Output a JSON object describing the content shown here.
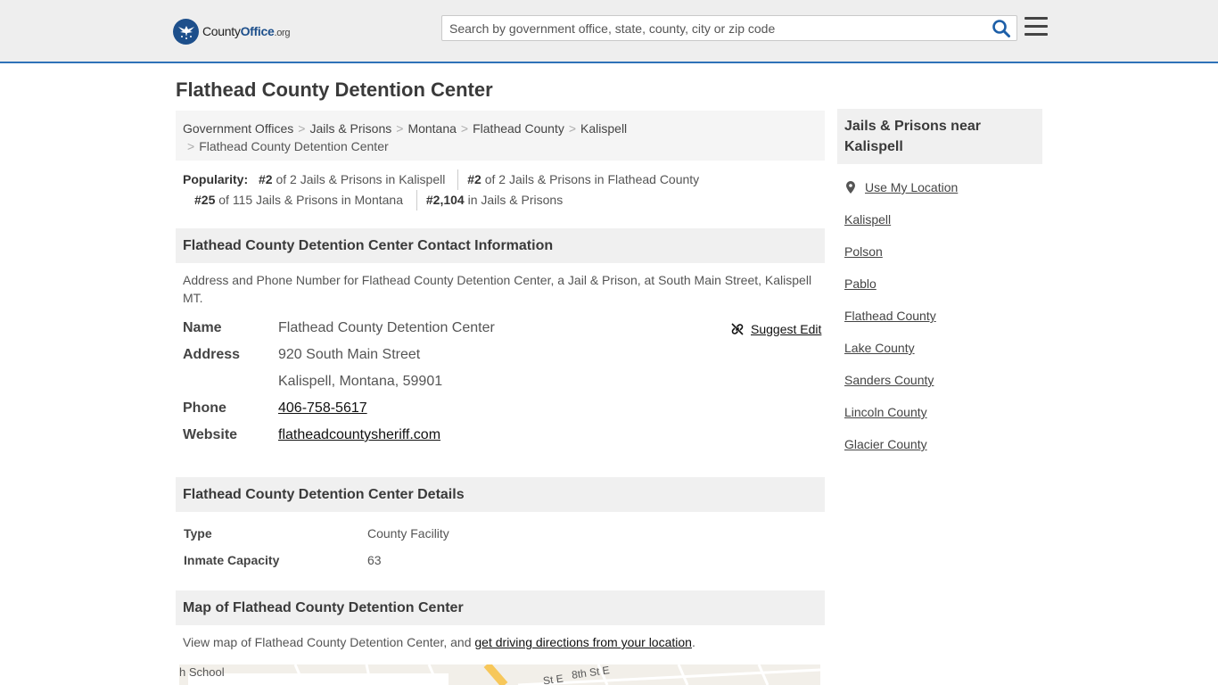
{
  "header": {
    "logo": {
      "county": "County",
      "office": "Office",
      "org": ".org"
    },
    "search_placeholder": "Search by government office, state, county, city or zip code"
  },
  "page_title": "Flathead County Detention Center",
  "breadcrumb": [
    "Government Offices",
    "Jails & Prisons",
    "Montana",
    "Flathead County",
    "Kalispell",
    "Flathead County Detention Center"
  ],
  "popularity": {
    "label": "Popularity:",
    "items": [
      {
        "rank": "#2",
        "text": " of 2 Jails & Prisons in Kalispell"
      },
      {
        "rank": "#2",
        "text": " of 2 Jails & Prisons in Flathead County"
      },
      {
        "rank": "#25",
        "text": " of 115 Jails & Prisons in Montana"
      },
      {
        "rank": "#2,104",
        "text": " in Jails & Prisons"
      }
    ]
  },
  "contact": {
    "heading": "Flathead County Detention Center Contact Information",
    "description": "Address and Phone Number for Flathead County Detention Center, a Jail & Prison, at South Main Street, Kalispell MT.",
    "suggest_edit": "Suggest Edit",
    "name_label": "Name",
    "name": "Flathead County Detention Center",
    "address_label": "Address",
    "address_line1": "920 South Main Street",
    "address_line2": "Kalispell, Montana, 59901",
    "phone_label": "Phone",
    "phone": "406-758-5617",
    "website_label": "Website",
    "website": "flatheadcountysheriff.com"
  },
  "details": {
    "heading": "Flathead County Detention Center Details",
    "rows": [
      {
        "label": "Type",
        "value": "County Facility"
      },
      {
        "label": "Inmate Capacity",
        "value": "63"
      }
    ]
  },
  "map": {
    "heading": "Map of Flathead County Detention Center",
    "desc_prefix": "View map of Flathead County Detention Center, and ",
    "desc_link": "get driving directions from your location",
    "desc_suffix": ".",
    "labels": [
      "h School",
      "8th St E",
      "St E"
    ]
  },
  "sidebar": {
    "heading": "Jails & Prisons near Kalispell",
    "use_location": "Use My Location",
    "links": [
      "Kalispell",
      "Polson",
      "Pablo",
      "Flathead County",
      "Lake County",
      "Sanders County",
      "Lincoln County",
      "Glacier County"
    ]
  },
  "colors": {
    "accent": "#2f72b8",
    "logo": "#1d4f8b",
    "header_bg": "#eeeeee",
    "section_bg": "#f0f0f0"
  }
}
